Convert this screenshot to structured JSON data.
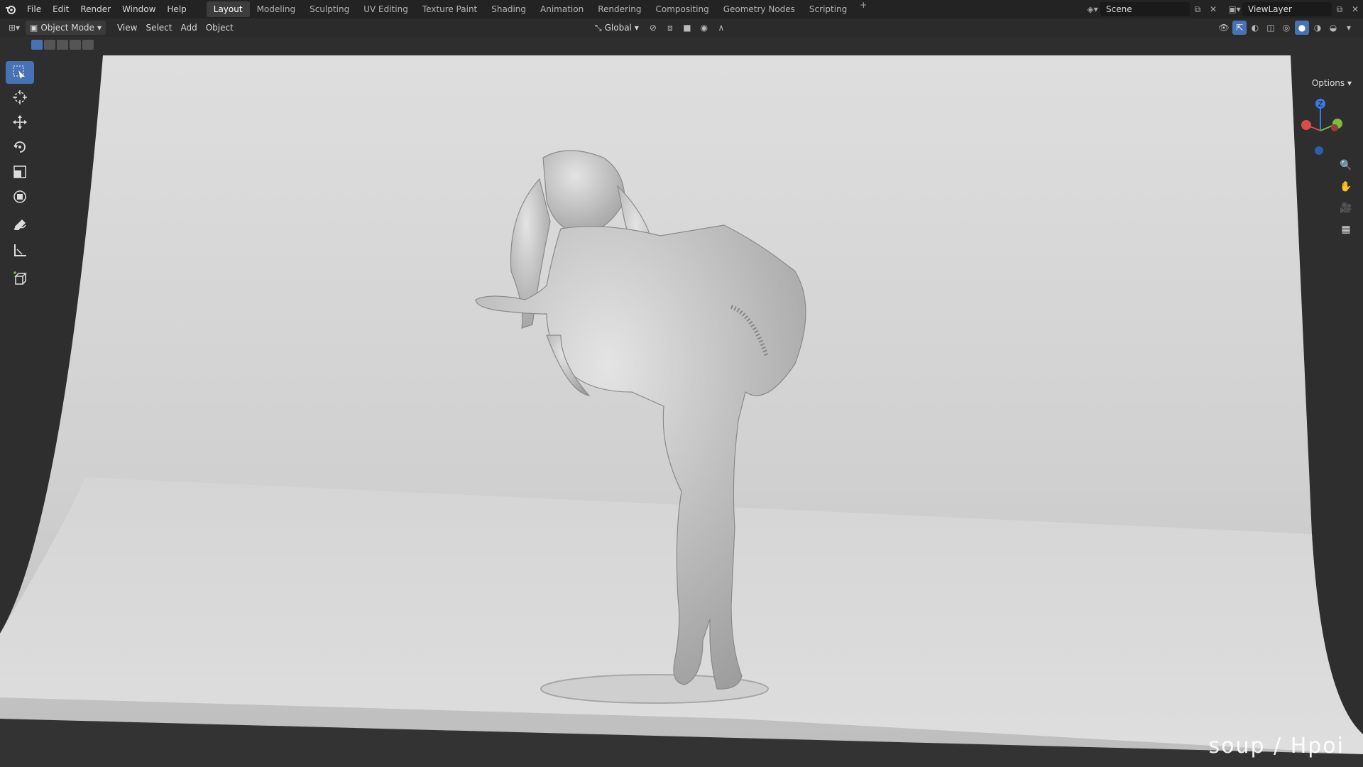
{
  "menu": [
    "File",
    "Edit",
    "Render",
    "Window",
    "Help"
  ],
  "workspaces": [
    {
      "label": "Layout",
      "active": true
    },
    {
      "label": "Modeling"
    },
    {
      "label": "Sculpting"
    },
    {
      "label": "UV Editing"
    },
    {
      "label": "Texture Paint"
    },
    {
      "label": "Shading"
    },
    {
      "label": "Animation"
    },
    {
      "label": "Rendering"
    },
    {
      "label": "Compositing"
    },
    {
      "label": "Geometry Nodes"
    },
    {
      "label": "Scripting"
    }
  ],
  "scene": {
    "name": "Scene",
    "view_layer": "ViewLayer"
  },
  "header": {
    "mode": "Object Mode",
    "menus": [
      "View",
      "Select",
      "Add",
      "Object"
    ],
    "orientation": "Global"
  },
  "viewport": {
    "options_label": "Options",
    "gizmo_axes": [
      "Z",
      "Y",
      "X"
    ],
    "watermark": "soup / Hpoi"
  },
  "tools": [
    {
      "name": "select-box",
      "active": true
    },
    {
      "name": "cursor"
    },
    {
      "name": "move"
    },
    {
      "name": "rotate"
    },
    {
      "name": "scale"
    },
    {
      "name": "transform"
    },
    {
      "name": "annotate"
    },
    {
      "name": "measure"
    },
    {
      "name": "add-cube"
    }
  ],
  "colors": {
    "accent": "#4772b3",
    "axis_x": "#d94c4c",
    "axis_y": "#7bbd3c",
    "axis_z": "#3a7de0"
  }
}
